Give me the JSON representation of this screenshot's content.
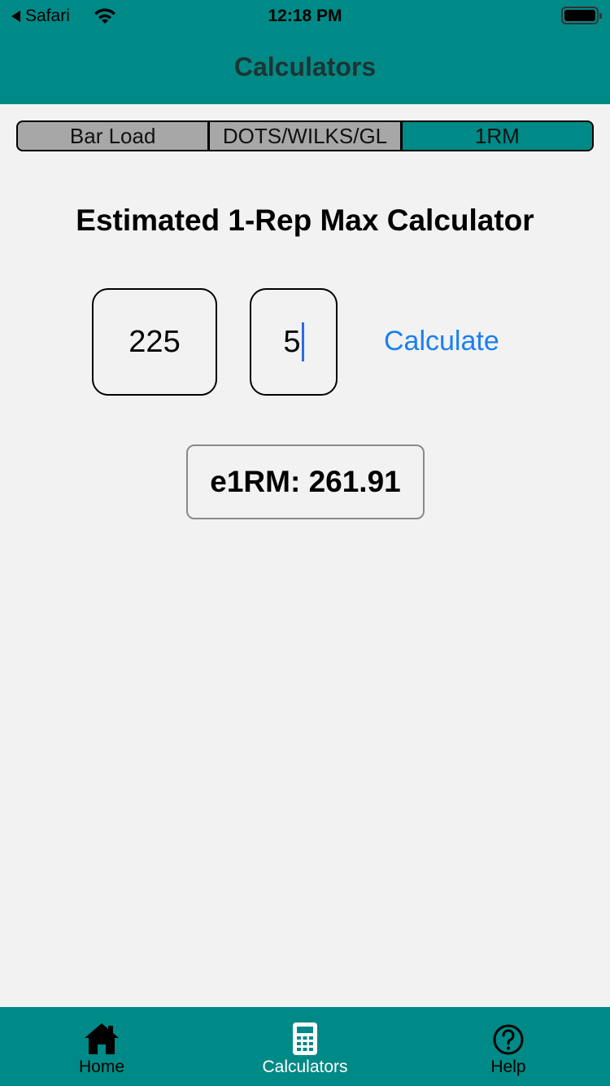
{
  "status_bar": {
    "back_app": "Safari",
    "time": "12:18 PM"
  },
  "nav": {
    "title": "Calculators"
  },
  "segments": [
    {
      "label": "Bar Load",
      "active": false
    },
    {
      "label": "DOTS/WILKS/GL",
      "active": false
    },
    {
      "label": "1RM",
      "active": true
    }
  ],
  "calculator": {
    "title": "Estimated 1-Rep Max Calculator",
    "weight_value": "225",
    "reps_value": "5",
    "calculate_label": "Calculate",
    "result_text": "e1RM: 261.91"
  },
  "tab_bar": {
    "items": [
      {
        "label": "Home",
        "icon": "home-icon",
        "active": false
      },
      {
        "label": "Calculators",
        "icon": "calculator-icon",
        "active": true
      },
      {
        "label": "Help",
        "icon": "help-icon",
        "active": false
      }
    ]
  },
  "colors": {
    "teal": "#008a87",
    "segment_inactive": "#a7a7a7",
    "link_blue": "#1a7ff2",
    "background": "#f2f2f2"
  }
}
